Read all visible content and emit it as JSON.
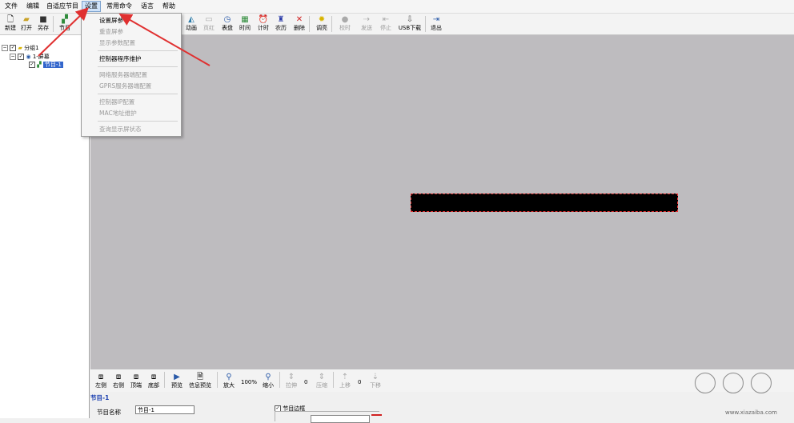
{
  "menubar": {
    "items": [
      "文件",
      "编辑",
      "自适应节目",
      "设置",
      "常用命令",
      "语言",
      "帮助"
    ]
  },
  "toolbar": {
    "new": "新建",
    "open": "打开",
    "save_as": "另存",
    "program": "节目",
    "animation": "动画",
    "clock": "表盘",
    "time": "时间",
    "timer": "计时",
    "lunar": "农历",
    "delete": "删除",
    "brightness": "调亮",
    "disabled_1": "页红",
    "disabled_2": "校时",
    "send": "发送",
    "stop": "停止",
    "usb_download": "USB下载",
    "exit": "退出"
  },
  "tree": {
    "group": "分组1",
    "screen": "1-屏幕",
    "program": "节目-1"
  },
  "settings_menu": {
    "items": [
      {
        "label": "设置屏参",
        "enabled": true
      },
      {
        "label": "重查屏参",
        "enabled": false
      },
      {
        "label": "显示参数配置",
        "enabled": false
      },
      {
        "label": "控制器程序维护",
        "enabled": true
      },
      {
        "label": "网络服务器端配置",
        "enabled": false
      },
      {
        "label": "GPRS服务器端配置",
        "enabled": false
      },
      {
        "label": "控制器IP配置",
        "enabled": false
      },
      {
        "label": "MAC地址维护",
        "enabled": false
      },
      {
        "label": "查询显示屏状态",
        "enabled": false
      }
    ]
  },
  "bottom_toolbar": {
    "left": "左侧",
    "right": "右侧",
    "top": "顶端",
    "bottom": "底部",
    "preview": "预览",
    "info_preview": "信息预览",
    "zoom_in": "放大",
    "zoom_value": "100%",
    "zoom_out": "缩小",
    "stretch": "拉伸",
    "stretch_value": "0",
    "compress": "压缩",
    "move_up": "上移",
    "move_value": "0",
    "move_down": "下移"
  },
  "properties": {
    "section_title": "节目-1",
    "name_label": "节目名称",
    "name_value": "节目-1",
    "border_label": "节目边框"
  },
  "watermark": {
    "text": "www.xiazaiba.com"
  },
  "colors": {
    "canvas_bg": "#bebcbf",
    "annotation_arrow": "#e03030",
    "screen_border": "#e03030",
    "menu_highlight": "#cfe3fa"
  }
}
